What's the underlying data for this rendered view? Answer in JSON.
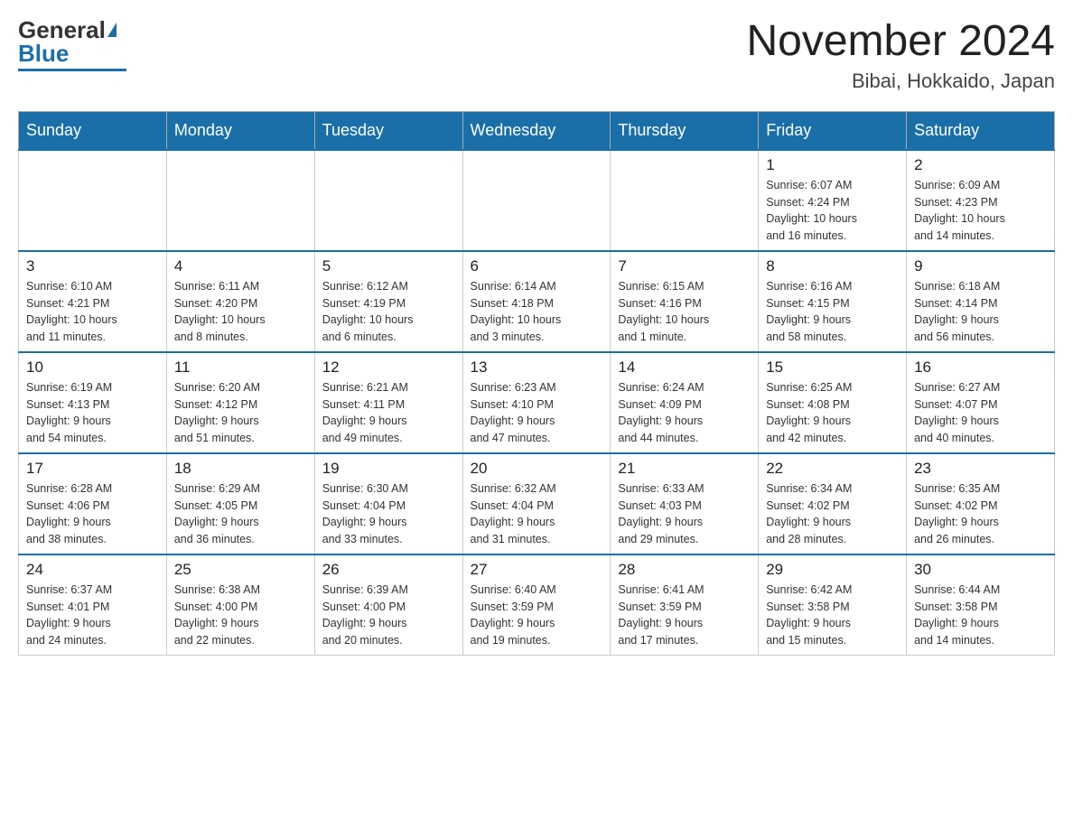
{
  "header": {
    "logo_general": "General",
    "logo_blue": "Blue",
    "month_title": "November 2024",
    "location": "Bibai, Hokkaido, Japan"
  },
  "weekdays": [
    "Sunday",
    "Monday",
    "Tuesday",
    "Wednesday",
    "Thursday",
    "Friday",
    "Saturday"
  ],
  "weeks": [
    [
      {
        "day": "",
        "info": ""
      },
      {
        "day": "",
        "info": ""
      },
      {
        "day": "",
        "info": ""
      },
      {
        "day": "",
        "info": ""
      },
      {
        "day": "",
        "info": ""
      },
      {
        "day": "1",
        "info": "Sunrise: 6:07 AM\nSunset: 4:24 PM\nDaylight: 10 hours\nand 16 minutes."
      },
      {
        "day": "2",
        "info": "Sunrise: 6:09 AM\nSunset: 4:23 PM\nDaylight: 10 hours\nand 14 minutes."
      }
    ],
    [
      {
        "day": "3",
        "info": "Sunrise: 6:10 AM\nSunset: 4:21 PM\nDaylight: 10 hours\nand 11 minutes."
      },
      {
        "day": "4",
        "info": "Sunrise: 6:11 AM\nSunset: 4:20 PM\nDaylight: 10 hours\nand 8 minutes."
      },
      {
        "day": "5",
        "info": "Sunrise: 6:12 AM\nSunset: 4:19 PM\nDaylight: 10 hours\nand 6 minutes."
      },
      {
        "day": "6",
        "info": "Sunrise: 6:14 AM\nSunset: 4:18 PM\nDaylight: 10 hours\nand 3 minutes."
      },
      {
        "day": "7",
        "info": "Sunrise: 6:15 AM\nSunset: 4:16 PM\nDaylight: 10 hours\nand 1 minute."
      },
      {
        "day": "8",
        "info": "Sunrise: 6:16 AM\nSunset: 4:15 PM\nDaylight: 9 hours\nand 58 minutes."
      },
      {
        "day": "9",
        "info": "Sunrise: 6:18 AM\nSunset: 4:14 PM\nDaylight: 9 hours\nand 56 minutes."
      }
    ],
    [
      {
        "day": "10",
        "info": "Sunrise: 6:19 AM\nSunset: 4:13 PM\nDaylight: 9 hours\nand 54 minutes."
      },
      {
        "day": "11",
        "info": "Sunrise: 6:20 AM\nSunset: 4:12 PM\nDaylight: 9 hours\nand 51 minutes."
      },
      {
        "day": "12",
        "info": "Sunrise: 6:21 AM\nSunset: 4:11 PM\nDaylight: 9 hours\nand 49 minutes."
      },
      {
        "day": "13",
        "info": "Sunrise: 6:23 AM\nSunset: 4:10 PM\nDaylight: 9 hours\nand 47 minutes."
      },
      {
        "day": "14",
        "info": "Sunrise: 6:24 AM\nSunset: 4:09 PM\nDaylight: 9 hours\nand 44 minutes."
      },
      {
        "day": "15",
        "info": "Sunrise: 6:25 AM\nSunset: 4:08 PM\nDaylight: 9 hours\nand 42 minutes."
      },
      {
        "day": "16",
        "info": "Sunrise: 6:27 AM\nSunset: 4:07 PM\nDaylight: 9 hours\nand 40 minutes."
      }
    ],
    [
      {
        "day": "17",
        "info": "Sunrise: 6:28 AM\nSunset: 4:06 PM\nDaylight: 9 hours\nand 38 minutes."
      },
      {
        "day": "18",
        "info": "Sunrise: 6:29 AM\nSunset: 4:05 PM\nDaylight: 9 hours\nand 36 minutes."
      },
      {
        "day": "19",
        "info": "Sunrise: 6:30 AM\nSunset: 4:04 PM\nDaylight: 9 hours\nand 33 minutes."
      },
      {
        "day": "20",
        "info": "Sunrise: 6:32 AM\nSunset: 4:04 PM\nDaylight: 9 hours\nand 31 minutes."
      },
      {
        "day": "21",
        "info": "Sunrise: 6:33 AM\nSunset: 4:03 PM\nDaylight: 9 hours\nand 29 minutes."
      },
      {
        "day": "22",
        "info": "Sunrise: 6:34 AM\nSunset: 4:02 PM\nDaylight: 9 hours\nand 28 minutes."
      },
      {
        "day": "23",
        "info": "Sunrise: 6:35 AM\nSunset: 4:02 PM\nDaylight: 9 hours\nand 26 minutes."
      }
    ],
    [
      {
        "day": "24",
        "info": "Sunrise: 6:37 AM\nSunset: 4:01 PM\nDaylight: 9 hours\nand 24 minutes."
      },
      {
        "day": "25",
        "info": "Sunrise: 6:38 AM\nSunset: 4:00 PM\nDaylight: 9 hours\nand 22 minutes."
      },
      {
        "day": "26",
        "info": "Sunrise: 6:39 AM\nSunset: 4:00 PM\nDaylight: 9 hours\nand 20 minutes."
      },
      {
        "day": "27",
        "info": "Sunrise: 6:40 AM\nSunset: 3:59 PM\nDaylight: 9 hours\nand 19 minutes."
      },
      {
        "day": "28",
        "info": "Sunrise: 6:41 AM\nSunset: 3:59 PM\nDaylight: 9 hours\nand 17 minutes."
      },
      {
        "day": "29",
        "info": "Sunrise: 6:42 AM\nSunset: 3:58 PM\nDaylight: 9 hours\nand 15 minutes."
      },
      {
        "day": "30",
        "info": "Sunrise: 6:44 AM\nSunset: 3:58 PM\nDaylight: 9 hours\nand 14 minutes."
      }
    ]
  ]
}
